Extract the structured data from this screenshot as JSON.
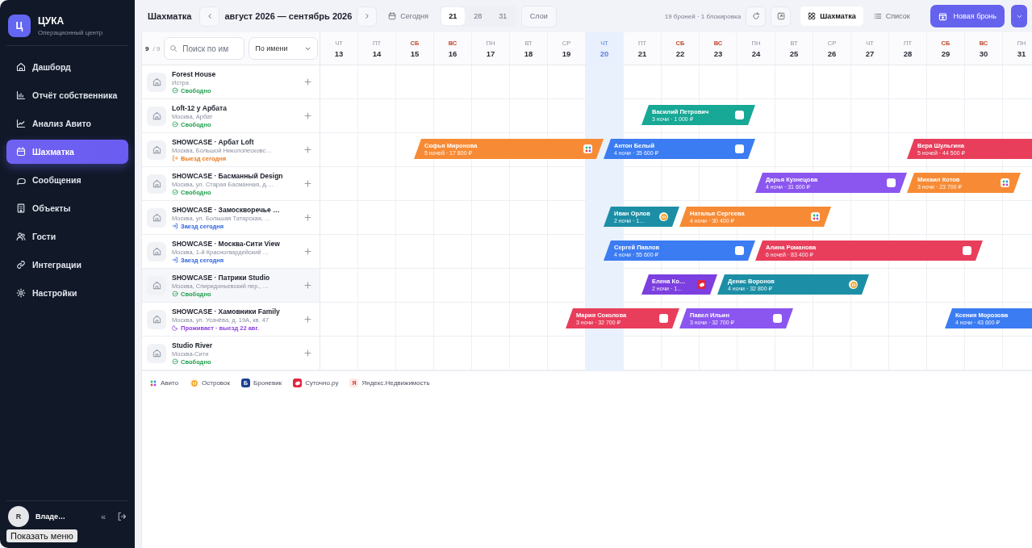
{
  "sidebar": {
    "logo_letter": "Ц",
    "app_name": "ЦУКА",
    "subtitle": "Операционный центр",
    "items": [
      {
        "label": "Дашборд",
        "selected": false
      },
      {
        "label": "Отчёт собственника",
        "selected": false
      },
      {
        "label": "Анализ Авито",
        "selected": false
      },
      {
        "label": "Шахматка",
        "selected": true
      },
      {
        "label": "Сообщения",
        "selected": false
      },
      {
        "label": "Объекты",
        "selected": false
      },
      {
        "label": "Гости",
        "selected": false
      },
      {
        "label": "Интеграции",
        "selected": false
      },
      {
        "label": "Настройки",
        "selected": false
      }
    ],
    "user": {
      "initial": "R",
      "name": "Владе…",
      "collapse": "«"
    },
    "tooltip": "Показать меню"
  },
  "toolbar": {
    "title": "Шахматка",
    "range": "август 2026 — сентябрь 2026",
    "today": "Сегодня",
    "periods": [
      {
        "label": "21",
        "selected": true
      },
      {
        "label": "28",
        "selected": false
      },
      {
        "label": "31",
        "selected": false
      }
    ],
    "layers": "Слои",
    "summary": "19 броней · 1 блокировка",
    "views": [
      {
        "label": "Шахматка",
        "selected": true
      },
      {
        "label": "Список",
        "selected": false
      }
    ],
    "new_booking": "Новая бронь"
  },
  "filter": {
    "shown": "9",
    "total": "/ 9",
    "search_placeholder": "Поиск по им",
    "sort": "По имени"
  },
  "days": [
    {
      "weekday": "ЧТ",
      "number": "13",
      "kind": "weekday",
      "today": false
    },
    {
      "weekday": "ПТ",
      "number": "14",
      "kind": "weekday",
      "today": false
    },
    {
      "weekday": "СБ",
      "number": "15",
      "kind": "weekend",
      "today": false
    },
    {
      "weekday": "ВС",
      "number": "16",
      "kind": "weekend",
      "today": false
    },
    {
      "weekday": "ПН",
      "number": "17",
      "kind": "weekday",
      "today": false
    },
    {
      "weekday": "ВТ",
      "number": "18",
      "kind": "weekday",
      "today": false
    },
    {
      "weekday": "СР",
      "number": "19",
      "kind": "weekday",
      "today": false
    },
    {
      "weekday": "ЧТ",
      "number": "20",
      "kind": "weekday",
      "today": true
    },
    {
      "weekday": "ПТ",
      "number": "21",
      "kind": "weekday",
      "today": false
    },
    {
      "weekday": "СБ",
      "number": "22",
      "kind": "weekend",
      "today": false
    },
    {
      "weekday": "ВС",
      "number": "23",
      "kind": "weekend",
      "today": false
    },
    {
      "weekday": "ПН",
      "number": "24",
      "kind": "weekday",
      "today": false
    },
    {
      "weekday": "ВТ",
      "number": "25",
      "kind": "weekday",
      "today": false
    },
    {
      "weekday": "СР",
      "number": "26",
      "kind": "weekday",
      "today": false
    },
    {
      "weekday": "ЧТ",
      "number": "27",
      "kind": "weekday",
      "today": false
    },
    {
      "weekday": "ПТ",
      "number": "28",
      "kind": "weekday",
      "today": false
    },
    {
      "weekday": "СБ",
      "number": "29",
      "kind": "weekend",
      "today": false
    },
    {
      "weekday": "ВС",
      "number": "30",
      "kind": "weekend",
      "today": false
    },
    {
      "weekday": "ПН",
      "number": "31",
      "kind": "weekday",
      "today": false
    }
  ],
  "properties": [
    {
      "name": "Forest House",
      "address": "Истра",
      "status": "Свободно",
      "kind": "free",
      "hovered": false
    },
    {
      "name": "Loft-12 у Арбата",
      "address": "Москва, Арбат",
      "status": "Свободно",
      "kind": "free",
      "hovered": false,
      "bookings": [
        {
          "guest": "Василий Петрович",
          "details": "3 ночи · 1 000 ₽",
          "color": "#17a896",
          "kind": "none"
        }
      ]
    },
    {
      "name": "SHOWCASE · Арбат Loft",
      "address": "Москва, Большой Николопесковс…",
      "status": "Выезд сегодня",
      "kind": "checkout",
      "hovered": false,
      "bookings": [
        {
          "guest": "Софья Миронова",
          "details": "5 ночей · 17 800 ₽",
          "color": "#f78b35",
          "kind": "avito"
        },
        {
          "guest": "Антон Белый",
          "details": "4 ночи · 35 600 ₽",
          "color": "#3b7cf2",
          "kind": "none"
        },
        {
          "guest": "Вера Шульгина",
          "details": "5 ночей · 44 500 ₽",
          "color": "#e83e5c",
          "kind": "none"
        }
      ]
    },
    {
      "name": "SHOWCASE · Басманный Design",
      "address": "Москва, ул. Старая Басманная, д.…",
      "status": "Свободно",
      "kind": "free",
      "hovered": false,
      "bookings": [
        {
          "guest": "Дарья Кузнецова",
          "details": "4 ночи · 31 600 ₽",
          "color": "#8b55f0",
          "kind": "none"
        },
        {
          "guest": "Михаил Котов",
          "details": "3 ночи · 23 700 ₽",
          "color": "#f78b35",
          "kind": "avito"
        }
      ]
    },
    {
      "name": "SHOWCASE · Замоскворечье …",
      "address": "Москва, ул. Большая Татарская, …",
      "status": "Заезд сегодня",
      "kind": "checkin",
      "hovered": false,
      "bookings": [
        {
          "guest": "Иван Орлов",
          "details": "2 ночи · 1…",
          "color": "#1c8fa6",
          "kind": "ostrovok"
        },
        {
          "guest": "Наталья Сергеева",
          "details": "4 ночи · 30 400 ₽",
          "color": "#f78b35",
          "kind": "avito"
        }
      ]
    },
    {
      "name": "SHOWCASE · Москва-Сити View",
      "address": "Москва, 1-й Красногвардейский …",
      "status": "Заезд сегодня",
      "kind": "checkin",
      "hovered": false,
      "bookings": [
        {
          "guest": "Сергей Павлов",
          "details": "4 ночи · 55 600 ₽",
          "color": "#3b7cf2",
          "kind": "none"
        },
        {
          "guest": "Алина Романова",
          "details": "6 ночей · 83 400 ₽",
          "color": "#e83e5c",
          "kind": "none"
        }
      ]
    },
    {
      "name": "SHOWCASE · Патрики Studio",
      "address": "Москва, Спиридоньевский пер., …",
      "status": "Свободно",
      "kind": "free",
      "hovered": true,
      "bookings": [
        {
          "guest": "Елена Ко…",
          "details": "2 ночи · 1…",
          "color": "#7c3fe0",
          "kind": "sutochno"
        },
        {
          "guest": "Денис Воронов",
          "details": "4 ночи · 32 800 ₽",
          "color": "#1c8fa6",
          "kind": "ostrovok"
        }
      ]
    },
    {
      "name": "SHOWCASE · Хамовники Family",
      "address": "Москва, ул. Усачёва, д. 19А, кв. 47",
      "status": "Проживает · выезд 22 авг.",
      "kind": "staying",
      "hovered": false,
      "bookings": [
        {
          "guest": "Мария Соколова",
          "details": "3 ночи · 32 700 ₽",
          "color": "#e83e5c",
          "kind": "none"
        },
        {
          "guest": "Павел Ильин",
          "details": "3 ночи · 32 700 ₽",
          "color": "#8b55f0",
          "kind": "none"
        },
        {
          "guest": "Ксения Морозова",
          "details": "4 ночи · 43 600 ₽",
          "color": "#3b7cf2",
          "kind": "none"
        }
      ]
    },
    {
      "name": "Studio River",
      "address": "Москва-Сити",
      "status": "Свободно",
      "kind": "free",
      "hovered": false
    }
  ],
  "legend": [
    {
      "label": "Авито",
      "kind": "avito"
    },
    {
      "label": "Островок",
      "kind": "ostrovok"
    },
    {
      "label": "Броневик",
      "kind": "bronevik",
      "logo_letter": "Б"
    },
    {
      "label": "Суточно.ру",
      "kind": "sutochno"
    },
    {
      "label": "Яндекс.Недвижимость",
      "kind": "yandex",
      "logo_letter": "Я"
    }
  ]
}
